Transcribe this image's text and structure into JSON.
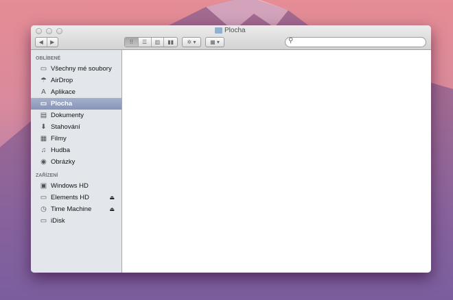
{
  "window": {
    "title": "Plocha"
  },
  "toolbar": {
    "back": "◀",
    "forward": "▶",
    "views": [
      "icon-view",
      "list-view",
      "column-view",
      "coverflow-view"
    ],
    "action": "✲ ▾",
    "arrange": "▦ ▾",
    "search_placeholder": ""
  },
  "sidebar": {
    "favorites_header": "OBLÍBENÉ",
    "favorites": [
      {
        "label": "Všechny mé soubory",
        "icon": "all-files-icon",
        "glyph": "▭"
      },
      {
        "label": "AirDrop",
        "icon": "airdrop-icon",
        "glyph": "☂"
      },
      {
        "label": "Aplikace",
        "icon": "applications-icon",
        "glyph": "A"
      },
      {
        "label": "Plocha",
        "icon": "desktop-icon",
        "glyph": "▭",
        "selected": true
      },
      {
        "label": "Dokumenty",
        "icon": "documents-icon",
        "glyph": "▤"
      },
      {
        "label": "Stahování",
        "icon": "downloads-icon",
        "glyph": "⬇"
      },
      {
        "label": "Filmy",
        "icon": "movies-icon",
        "glyph": "▦"
      },
      {
        "label": "Hudba",
        "icon": "music-icon",
        "glyph": "♫"
      },
      {
        "label": "Obrázky",
        "icon": "pictures-icon",
        "glyph": "◉"
      }
    ],
    "devices_header": "ZAŘÍZENÍ",
    "devices": [
      {
        "label": "Windows HD",
        "icon": "disk-icon",
        "glyph": "▣"
      },
      {
        "label": "Elements HD",
        "icon": "disk-icon",
        "glyph": "▭",
        "eject": "⏏"
      },
      {
        "label": "Time Machine",
        "icon": "time-machine-icon",
        "glyph": "◷",
        "eject": "⏏"
      },
      {
        "label": "iDisk",
        "icon": "idisk-icon",
        "glyph": "▭"
      }
    ]
  }
}
